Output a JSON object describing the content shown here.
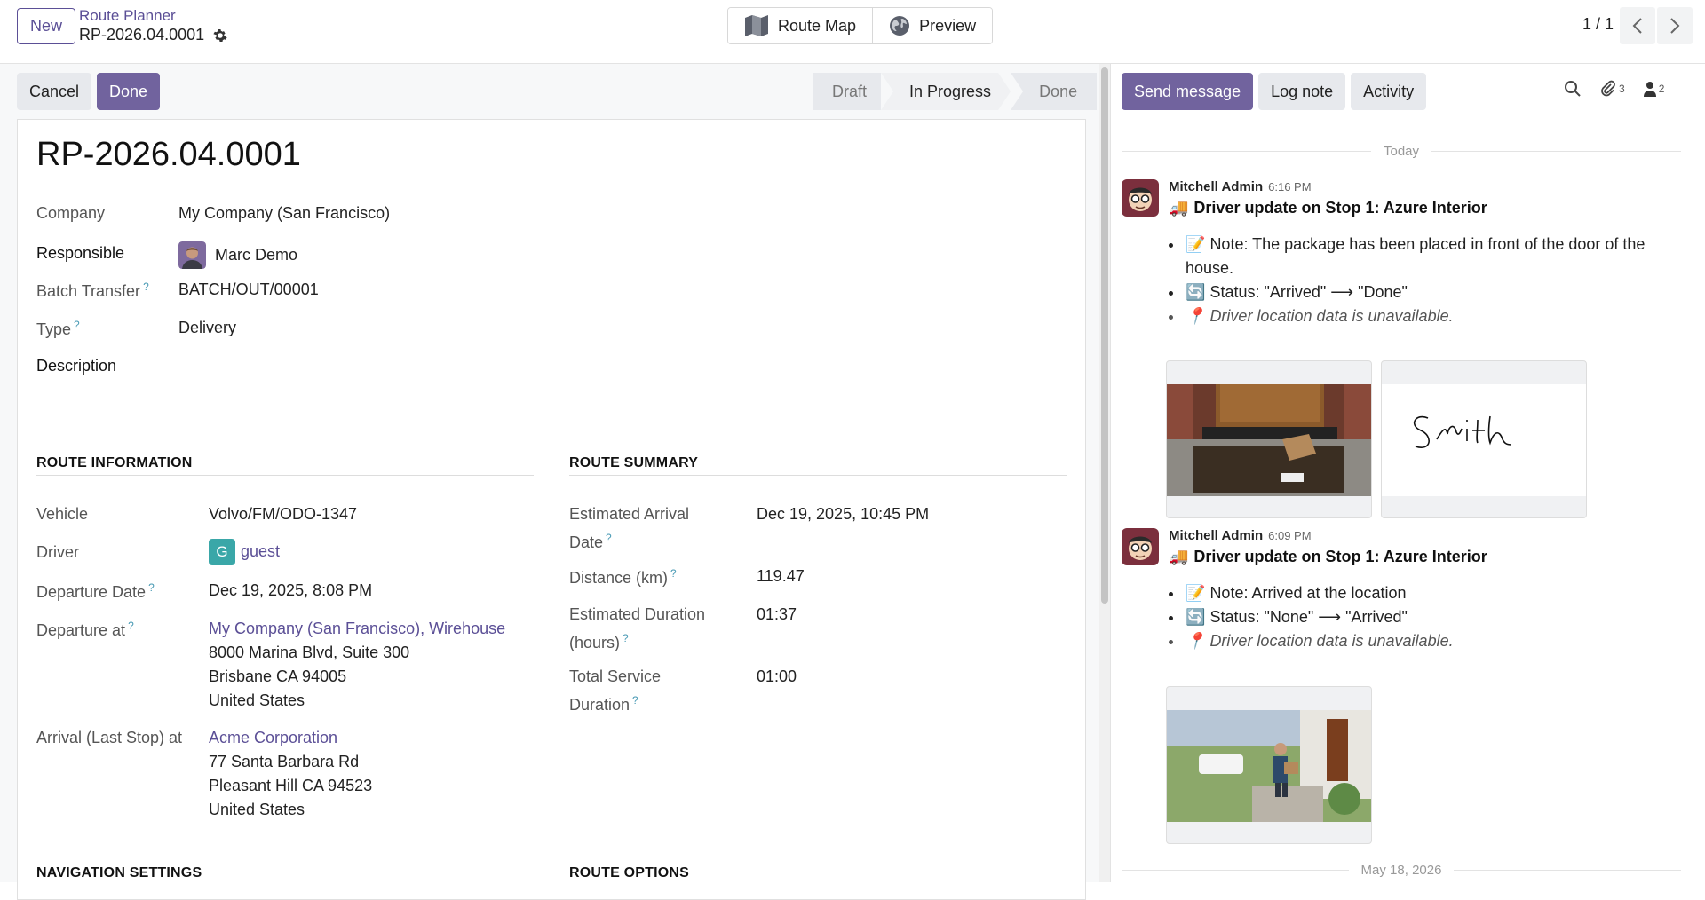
{
  "topbar": {
    "new_label": "New",
    "app_name": "Route Planner",
    "record_ref": "RP-2026.04.0001",
    "route_map_label": "Route Map",
    "preview_label": "Preview",
    "pager": "1 / 1"
  },
  "actions": {
    "cancel_label": "Cancel",
    "done_label": "Done"
  },
  "status": {
    "steps": [
      "Draft",
      "In Progress",
      "Done"
    ],
    "current": "In Progress"
  },
  "form": {
    "title": "RP-2026.04.0001",
    "company_label": "Company",
    "company_value": "My Company (San Francisco)",
    "responsible_label": "Responsible",
    "responsible_value": "Marc Demo",
    "batch_label": "Batch Transfer",
    "batch_value": "BATCH/OUT/00001",
    "type_label": "Type",
    "type_value": "Delivery",
    "description_label": "Description",
    "tip": "?"
  },
  "route_info": {
    "heading": "ROUTE INFORMATION",
    "vehicle_label": "Vehicle",
    "vehicle_value": "Volvo/FM/ODO-1347",
    "driver_label": "Driver",
    "driver_initial": "G",
    "driver_value": "guest",
    "departure_date_label": "Departure Date",
    "departure_date_value": "Dec 19, 2025, 8:08 PM",
    "departure_at_label": "Departure at",
    "departure_at_link": "My Company (San Francisco), Wirehouse",
    "departure_addr1": "8000 Marina Blvd, Suite 300",
    "departure_addr2": "Brisbane CA 94005",
    "departure_addr3": "United States",
    "arrival_label": "Arrival (Last Stop) at",
    "arrival_link": "Acme Corporation",
    "arrival_addr1": "77 Santa Barbara Rd",
    "arrival_addr2": "Pleasant Hill CA 94523",
    "arrival_addr3": "United States"
  },
  "route_summary": {
    "heading": "ROUTE SUMMARY",
    "eta_label_1": "Estimated Arrival",
    "eta_label_2": "Date",
    "eta_value": "Dec 19, 2025, 10:45 PM",
    "distance_label": "Distance (km)",
    "distance_value": "119.47",
    "duration_label_1": "Estimated Duration",
    "duration_label_2": "(hours)",
    "duration_value": "01:37",
    "service_label_1": "Total Service",
    "service_label_2": "Duration",
    "service_value": "01:00"
  },
  "bottom_sections": {
    "navigation": "NAVIGATION SETTINGS",
    "options": "ROUTE OPTIONS"
  },
  "chatter": {
    "send_message": "Send message",
    "log_note": "Log note",
    "activity": "Activity",
    "attachments_count": "3",
    "followers_count": "2",
    "today": "Today",
    "older_date": "May 18, 2026",
    "messages": [
      {
        "author": "Mitchell Admin",
        "time": "6:16 PM",
        "title": "Driver update on Stop 1: Azure Interior",
        "note": "Note: The package has been placed in front of the door of the",
        "note_cont": "house.",
        "status": "Status: \"Arrived\"  ⟶  \"Done\"",
        "location": "Driver location data is unavailable."
      },
      {
        "author": "Mitchell Admin",
        "time": "6:09 PM",
        "title": "Driver update on Stop 1: Azure Interior",
        "note": "Note: Arrived at the location",
        "status": "Status: \"None\"  ⟶  \"Arrived\"",
        "location": "Driver location data is unavailable."
      }
    ]
  },
  "colors": {
    "primary": "#71639e",
    "link": "#5b4f96",
    "driver_badge": "#3aa7a8"
  }
}
